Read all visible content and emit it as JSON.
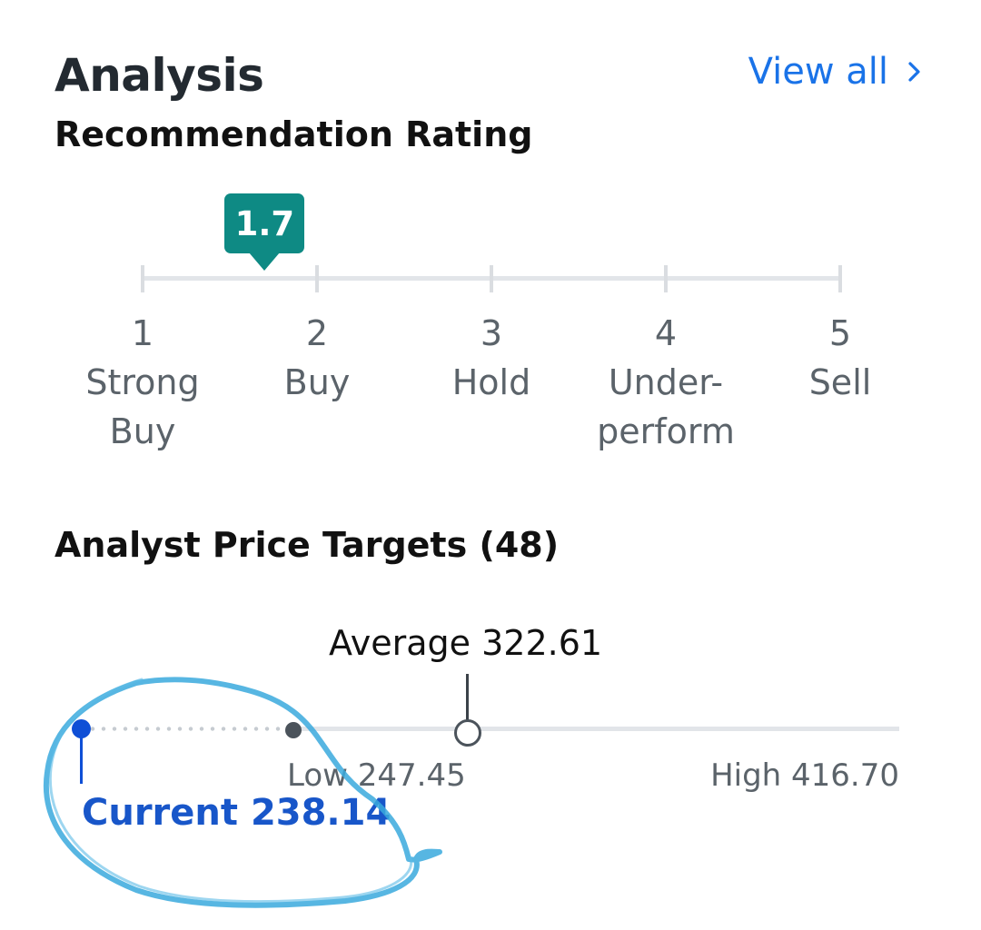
{
  "header": {
    "title": "Analysis",
    "view_all_label": "View all"
  },
  "recommendation": {
    "title": "Recommendation Rating",
    "value": 1.7,
    "value_label": "1.7",
    "scale_min": 1,
    "scale_max": 5,
    "scale": [
      {
        "number": "1",
        "line1": "Strong",
        "line2": "Buy"
      },
      {
        "number": "2",
        "line1": "Buy",
        "line2": ""
      },
      {
        "number": "3",
        "line1": "Hold",
        "line2": ""
      },
      {
        "number": "4",
        "line1": "Under-",
        "line2": "perform"
      },
      {
        "number": "5",
        "line1": "Sell",
        "line2": ""
      }
    ],
    "badge_color": "#0e8a84"
  },
  "price_targets": {
    "title": "Analyst Price Targets (48)",
    "average_label": "Average 322.61",
    "low_label": "Low 247.45",
    "high_label": "High 416.70",
    "current_label": "Current 238.14",
    "current_color": "#1856c9"
  },
  "icons": {
    "view_all": "chevron-right-icon"
  },
  "colors": {
    "link": "#1a73e8",
    "annotation": "#3aa9dd"
  }
}
